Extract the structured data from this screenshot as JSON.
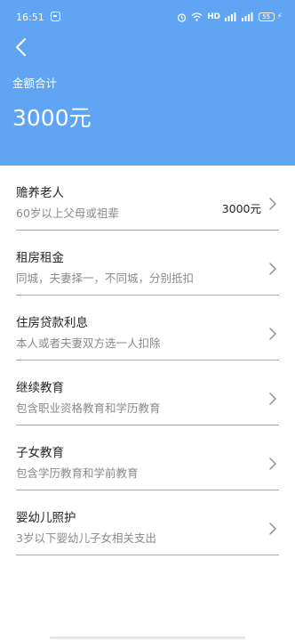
{
  "status": {
    "time": "16:51",
    "network": "HD",
    "battery": "55"
  },
  "header": {
    "summary_label": "金额合计",
    "summary_amount": "3000元"
  },
  "items": [
    {
      "title": "赡养老人",
      "desc": "60岁以上父母或祖辈",
      "value": "3000元"
    },
    {
      "title": "租房租金",
      "desc": "同城，夫妻择一，不同城，分别抵扣",
      "value": ""
    },
    {
      "title": "住房贷款利息",
      "desc": "本人或者夫妻双方选一人扣除",
      "value": ""
    },
    {
      "title": "继续教育",
      "desc": "包含职业资格教育和学历教育",
      "value": ""
    },
    {
      "title": "子女教育",
      "desc": "包含学历教育和学前教育",
      "value": ""
    },
    {
      "title": "婴幼儿照护",
      "desc": "3岁以下婴幼儿子女相关支出",
      "value": ""
    }
  ],
  "colors": {
    "header_bg": "#5fa5f3",
    "divider": "#a9a9a9",
    "title_text": "#262626",
    "desc_text": "#8a8a8a"
  },
  "icons": {
    "back": "back-arrow-icon",
    "chevron": "chevron-right-icon"
  }
}
